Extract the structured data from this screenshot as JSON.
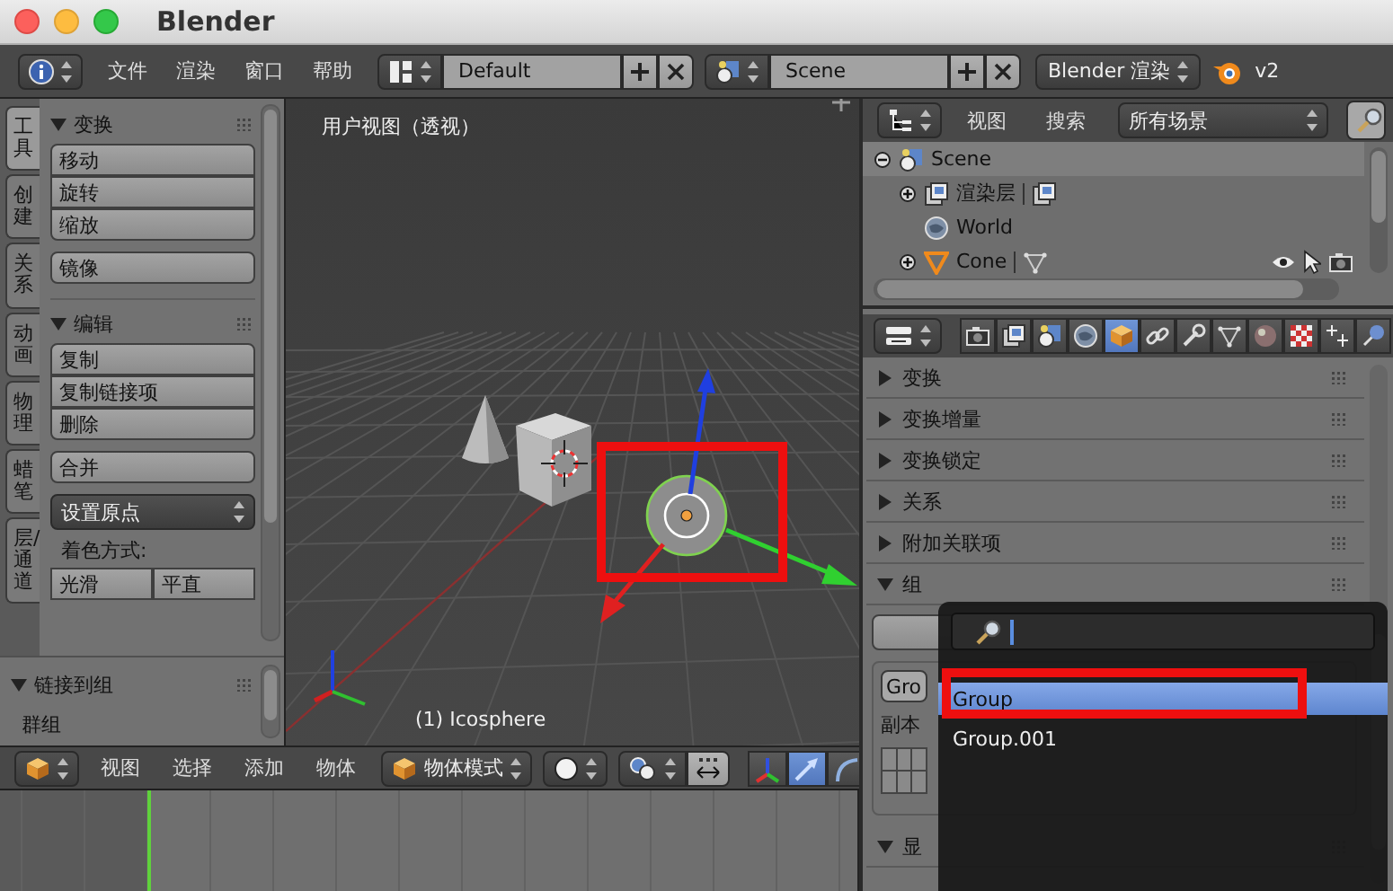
{
  "window": {
    "title": "Blender"
  },
  "info_header": {
    "menus": [
      "文件",
      "渲染",
      "窗口",
      "帮助"
    ],
    "screen_layout": "Default",
    "scene": "Scene",
    "render_engine": "Blender 渲染",
    "version": "v2"
  },
  "tool_tabs": [
    {
      "label": "工具",
      "selected": true
    },
    {
      "label": "创建",
      "selected": false
    },
    {
      "label": "关系",
      "selected": false
    },
    {
      "label": "动画",
      "selected": false
    },
    {
      "label": "物理",
      "selected": false
    },
    {
      "label": "蜡笔",
      "selected": false
    },
    {
      "label": "层/通道",
      "selected": false
    }
  ],
  "tool_panels": [
    {
      "title": "变换",
      "expanded": true,
      "items": [
        {
          "kind": "buttons",
          "labels": [
            "移动",
            "旋转",
            "缩放"
          ]
        },
        {
          "kind": "buttons",
          "labels": [
            "镜像"
          ]
        }
      ]
    },
    {
      "title": "编辑",
      "expanded": true,
      "items": [
        {
          "kind": "buttons",
          "labels": [
            "复制",
            "复制链接项",
            "删除"
          ]
        },
        {
          "kind": "buttons",
          "labels": [
            "合并"
          ]
        },
        {
          "kind": "dropdown",
          "label": "设置原点"
        },
        {
          "kind": "label",
          "text": "着色方式:"
        },
        {
          "kind": "toggle",
          "options": [
            {
              "label": "光滑",
              "selected": false
            },
            {
              "label": "平直",
              "selected": false
            }
          ]
        }
      ]
    }
  ],
  "link_panel": {
    "title": "链接到组",
    "expanded": true,
    "label": "群组"
  },
  "viewport": {
    "view_name": "用户视图（透视）",
    "active_object": "(1) Icosphere"
  },
  "view3d_header": {
    "menus": [
      "视图",
      "选择",
      "添加",
      "物体"
    ],
    "mode": "物体模式",
    "manipulators": [
      {
        "kind": "axes",
        "selected": false
      },
      {
        "kind": "translate",
        "selected": true
      },
      {
        "kind": "rotate",
        "selected": false
      }
    ]
  },
  "outliner": {
    "menus": [
      "视图",
      "搜索"
    ],
    "filter": "所有场景",
    "tree": [
      {
        "label": "Scene",
        "kind": "scene",
        "expanded": true,
        "selected": true,
        "children": [
          {
            "label": "渲染层",
            "kind": "render_layers",
            "expanded": false,
            "selected": false
          },
          {
            "label": "World",
            "kind": "world",
            "selected": false
          },
          {
            "label": "Cone",
            "kind": "mesh_object",
            "expanded": false,
            "selected": false
          }
        ]
      }
    ]
  },
  "properties": {
    "tabs": [
      {
        "kind": "camera",
        "selected": false
      },
      {
        "kind": "render_layers",
        "selected": false
      },
      {
        "kind": "scene",
        "selected": false
      },
      {
        "kind": "world",
        "selected": false
      },
      {
        "kind": "object",
        "selected": true
      },
      {
        "kind": "constraint",
        "selected": false
      },
      {
        "kind": "modifier",
        "selected": false
      },
      {
        "kind": "mesh_data",
        "selected": false
      },
      {
        "kind": "material",
        "selected": false
      },
      {
        "kind": "texture",
        "selected": false
      },
      {
        "kind": "particles",
        "selected": false
      },
      {
        "kind": "physics",
        "selected": false
      }
    ],
    "panels": [
      {
        "title": "变换",
        "expanded": false
      },
      {
        "title": "变换增量",
        "expanded": false
      },
      {
        "title": "变换锁定",
        "expanded": false
      },
      {
        "title": "关系",
        "expanded": false
      },
      {
        "title": "附加关联项",
        "expanded": false
      },
      {
        "title": "组",
        "expanded": true
      },
      {
        "title": "显",
        "expanded": true
      }
    ],
    "group_name": "Gro",
    "offset_label": "副本"
  },
  "group_menu": {
    "items": [
      {
        "label": "Group",
        "selected": true
      },
      {
        "label": "Group.001",
        "selected": false
      }
    ]
  }
}
